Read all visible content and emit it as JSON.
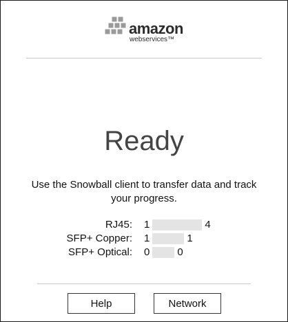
{
  "brand": {
    "name": "amazon",
    "subtitle": "webservices™"
  },
  "title": "Ready",
  "message": "Use the Snowball client to transfer data and track your progress.",
  "ports": [
    {
      "label": "RJ45:",
      "value_start": "1",
      "value_end": "4"
    },
    {
      "label": "SFP+ Copper:",
      "value_start": "1",
      "value_end": "1"
    },
    {
      "label": "SFP+ Optical:",
      "value_start": "0",
      "value_end": "0"
    }
  ],
  "buttons": {
    "help": "Help",
    "network": "Network"
  }
}
